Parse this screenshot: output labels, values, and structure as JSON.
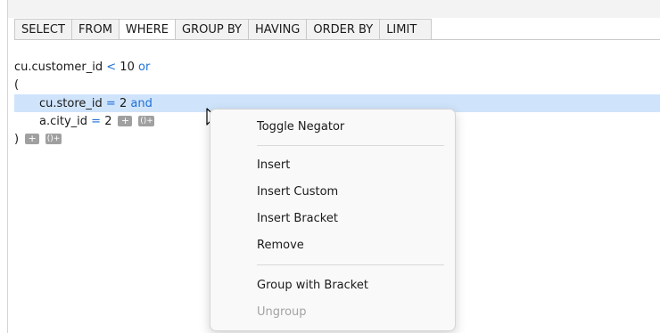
{
  "tabs": [
    {
      "label": "SELECT"
    },
    {
      "label": "FROM"
    },
    {
      "label": "WHERE"
    },
    {
      "label": "GROUP BY"
    },
    {
      "label": "HAVING"
    },
    {
      "label": "ORDER BY"
    },
    {
      "label": "LIMIT"
    }
  ],
  "active_tab": "WHERE",
  "editor": {
    "line1": {
      "field": "cu.customer_id",
      "operator": "<",
      "value": "10",
      "connector": "or"
    },
    "line2": {
      "bracket": "("
    },
    "line3": {
      "field": "cu.store_id",
      "operator": "=",
      "value": "2",
      "connector": "and"
    },
    "line4": {
      "field": "a.city_id",
      "operator": "=",
      "value": "2"
    },
    "line5": {
      "bracket": ")"
    },
    "add_button": "+",
    "bracket_button": "()+"
  },
  "context_menu": {
    "toggle_negator": "Toggle Negator",
    "insert": "Insert",
    "insert_custom": "Insert Custom",
    "insert_bracket": "Insert Bracket",
    "remove": "Remove",
    "group_with_bracket": "Group with Bracket",
    "ungroup": "Ungroup"
  },
  "colors": {
    "keyword": "#1f6fd8",
    "selected_line": "#cfe4fb",
    "mini_button": "#a0a0a0"
  }
}
